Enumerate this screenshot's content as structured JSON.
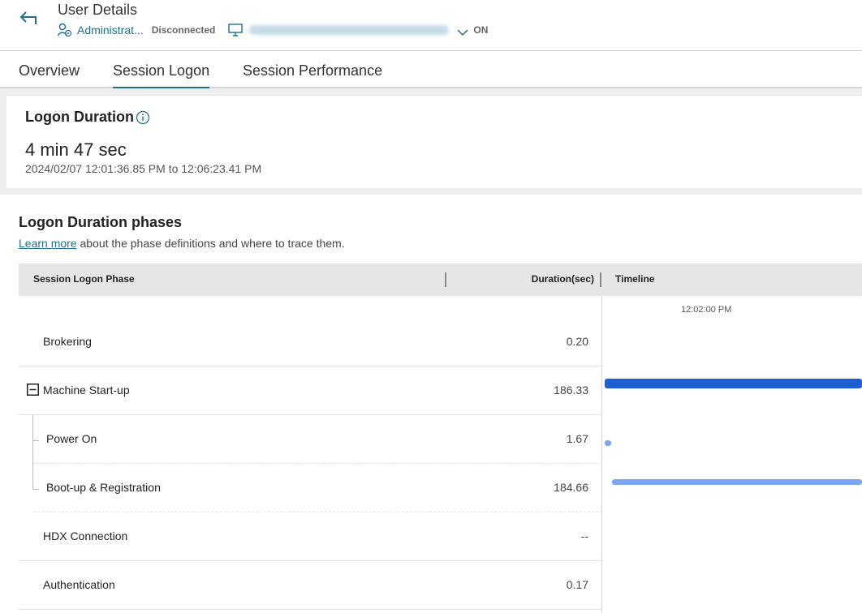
{
  "header": {
    "title": "User Details",
    "user": "Administrat...",
    "session_status": "Disconnected",
    "power_state": "ON"
  },
  "tabs": [
    {
      "label": "Overview",
      "active": false
    },
    {
      "label": "Session Logon",
      "active": true
    },
    {
      "label": "Session Performance",
      "active": false
    }
  ],
  "logon_duration": {
    "title": "Logon Duration",
    "value": "4 min 47 sec",
    "range": "2024/02/07 12:01:36.85 PM to 12:06:23.41 PM"
  },
  "phases": {
    "title": "Logon Duration phases",
    "learn_more": "Learn more",
    "description": " about the phase definitions and where to trace them.",
    "columns": {
      "phase": "Session Logon Phase",
      "duration": "Duration(sec)",
      "timeline": "Timeline"
    },
    "timeline_tick": "12:02:00 PM",
    "rows": [
      {
        "label": "Brokering",
        "value": "0.20"
      },
      {
        "label": "Machine Start-up",
        "value": "186.33"
      },
      {
        "label": "Power On",
        "value": "1.67"
      },
      {
        "label": "Boot-up & Registration",
        "value": "184.66"
      },
      {
        "label": "HDX Connection",
        "value": "--"
      },
      {
        "label": "Authentication",
        "value": "0.17"
      }
    ]
  },
  "colors": {
    "accent": "#1f6f8b",
    "bar_primary": "#1a5fd6",
    "bar_secondary": "#7aa7f0"
  }
}
